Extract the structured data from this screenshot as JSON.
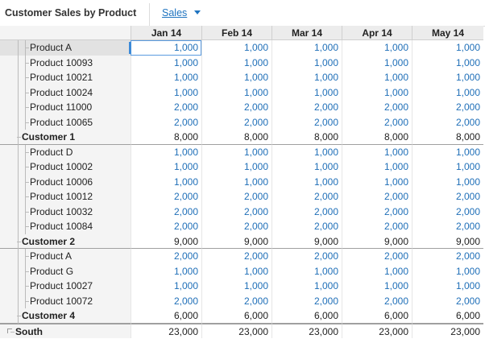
{
  "header": {
    "title": "Customer Sales by Product",
    "selector_label": "Sales"
  },
  "columns": [
    "Jan 14",
    "Feb 14",
    "Mar 14",
    "Apr 14",
    "May 14"
  ],
  "rows": [
    {
      "label": "Product A",
      "level": 3,
      "type": "input",
      "values": [
        "1,000",
        "1,000",
        "1,000",
        "1,000",
        "1,000"
      ]
    },
    {
      "label": "Product 10093",
      "level": 3,
      "type": "input",
      "values": [
        "1,000",
        "1,000",
        "1,000",
        "1,000",
        "1,000"
      ]
    },
    {
      "label": "Product 10021",
      "level": 3,
      "type": "input",
      "values": [
        "1,000",
        "1,000",
        "1,000",
        "1,000",
        "1,000"
      ]
    },
    {
      "label": "Product 10024",
      "level": 3,
      "type": "input",
      "values": [
        "1,000",
        "1,000",
        "1,000",
        "1,000",
        "1,000"
      ]
    },
    {
      "label": "Product 11000",
      "level": 3,
      "type": "input",
      "values": [
        "2,000",
        "2,000",
        "2,000",
        "2,000",
        "2,000"
      ]
    },
    {
      "label": "Product 10065",
      "level": 3,
      "type": "input",
      "values": [
        "2,000",
        "2,000",
        "2,000",
        "2,000",
        "2,000"
      ]
    },
    {
      "label": "Customer 1",
      "level": 2,
      "type": "total",
      "values": [
        "8,000",
        "8,000",
        "8,000",
        "8,000",
        "8,000"
      ]
    },
    {
      "label": "Product D",
      "level": 3,
      "type": "input",
      "values": [
        "1,000",
        "1,000",
        "1,000",
        "1,000",
        "1,000"
      ]
    },
    {
      "label": "Product 10002",
      "level": 3,
      "type": "input",
      "values": [
        "1,000",
        "1,000",
        "1,000",
        "1,000",
        "1,000"
      ]
    },
    {
      "label": "Product 10006",
      "level": 3,
      "type": "input",
      "values": [
        "1,000",
        "1,000",
        "1,000",
        "1,000",
        "1,000"
      ]
    },
    {
      "label": "Product 10012",
      "level": 3,
      "type": "input",
      "values": [
        "2,000",
        "2,000",
        "2,000",
        "2,000",
        "2,000"
      ]
    },
    {
      "label": "Product 10032",
      "level": 3,
      "type": "input",
      "values": [
        "2,000",
        "2,000",
        "2,000",
        "2,000",
        "2,000"
      ]
    },
    {
      "label": "Product 10084",
      "level": 3,
      "type": "input",
      "values": [
        "2,000",
        "2,000",
        "2,000",
        "2,000",
        "2,000"
      ]
    },
    {
      "label": "Customer 2",
      "level": 2,
      "type": "total",
      "values": [
        "9,000",
        "9,000",
        "9,000",
        "9,000",
        "9,000"
      ]
    },
    {
      "label": "Product A",
      "level": 3,
      "type": "input",
      "values": [
        "2,000",
        "2,000",
        "2,000",
        "2,000",
        "2,000"
      ]
    },
    {
      "label": "Product G",
      "level": 3,
      "type": "input",
      "values": [
        "1,000",
        "1,000",
        "1,000",
        "1,000",
        "1,000"
      ]
    },
    {
      "label": "Product 10027",
      "level": 3,
      "type": "input",
      "values": [
        "1,000",
        "1,000",
        "1,000",
        "1,000",
        "1,000"
      ]
    },
    {
      "label": "Product 10072",
      "level": 3,
      "type": "input",
      "values": [
        "2,000",
        "2,000",
        "2,000",
        "2,000",
        "2,000"
      ]
    },
    {
      "label": "Customer 4",
      "level": 2,
      "type": "total",
      "values": [
        "6,000",
        "6,000",
        "6,000",
        "6,000",
        "6,000"
      ]
    },
    {
      "label": "South",
      "level": 1,
      "type": "grand",
      "values": [
        "23,000",
        "23,000",
        "23,000",
        "23,000",
        "23,000"
      ]
    }
  ],
  "colors": {
    "input": "#1f6fb8",
    "calc": "#222222",
    "link": "#1f74c0"
  }
}
